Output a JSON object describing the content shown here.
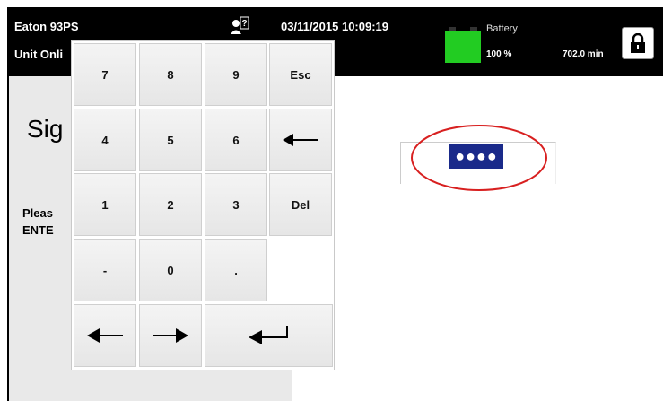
{
  "header": {
    "device_name": "Eaton 93PS",
    "unit_status": "Unit Onli",
    "datetime": "03/11/2015  10:09:19",
    "battery_label": "Battery",
    "battery_percent": "100 %",
    "battery_time": "702.0 min",
    "battery_level": 1.0
  },
  "dialog": {
    "title": "Sig",
    "message_line1": "Pleas",
    "message_line2": "ENTE"
  },
  "keypad": {
    "keys": [
      "7",
      "8",
      "9",
      "Esc",
      "4",
      "5",
      "6",
      "←",
      "1",
      "2",
      "3",
      "Del",
      "-",
      "0",
      "."
    ],
    "nav_left": "←",
    "nav_right": "→",
    "enter": "↵"
  },
  "password_field": {
    "value": "●●●●"
  },
  "colors": {
    "topbar": "#000000",
    "battery_green": "#22cc22",
    "password_bg": "#1a2a8a",
    "highlight_ellipse": "#d82020"
  }
}
